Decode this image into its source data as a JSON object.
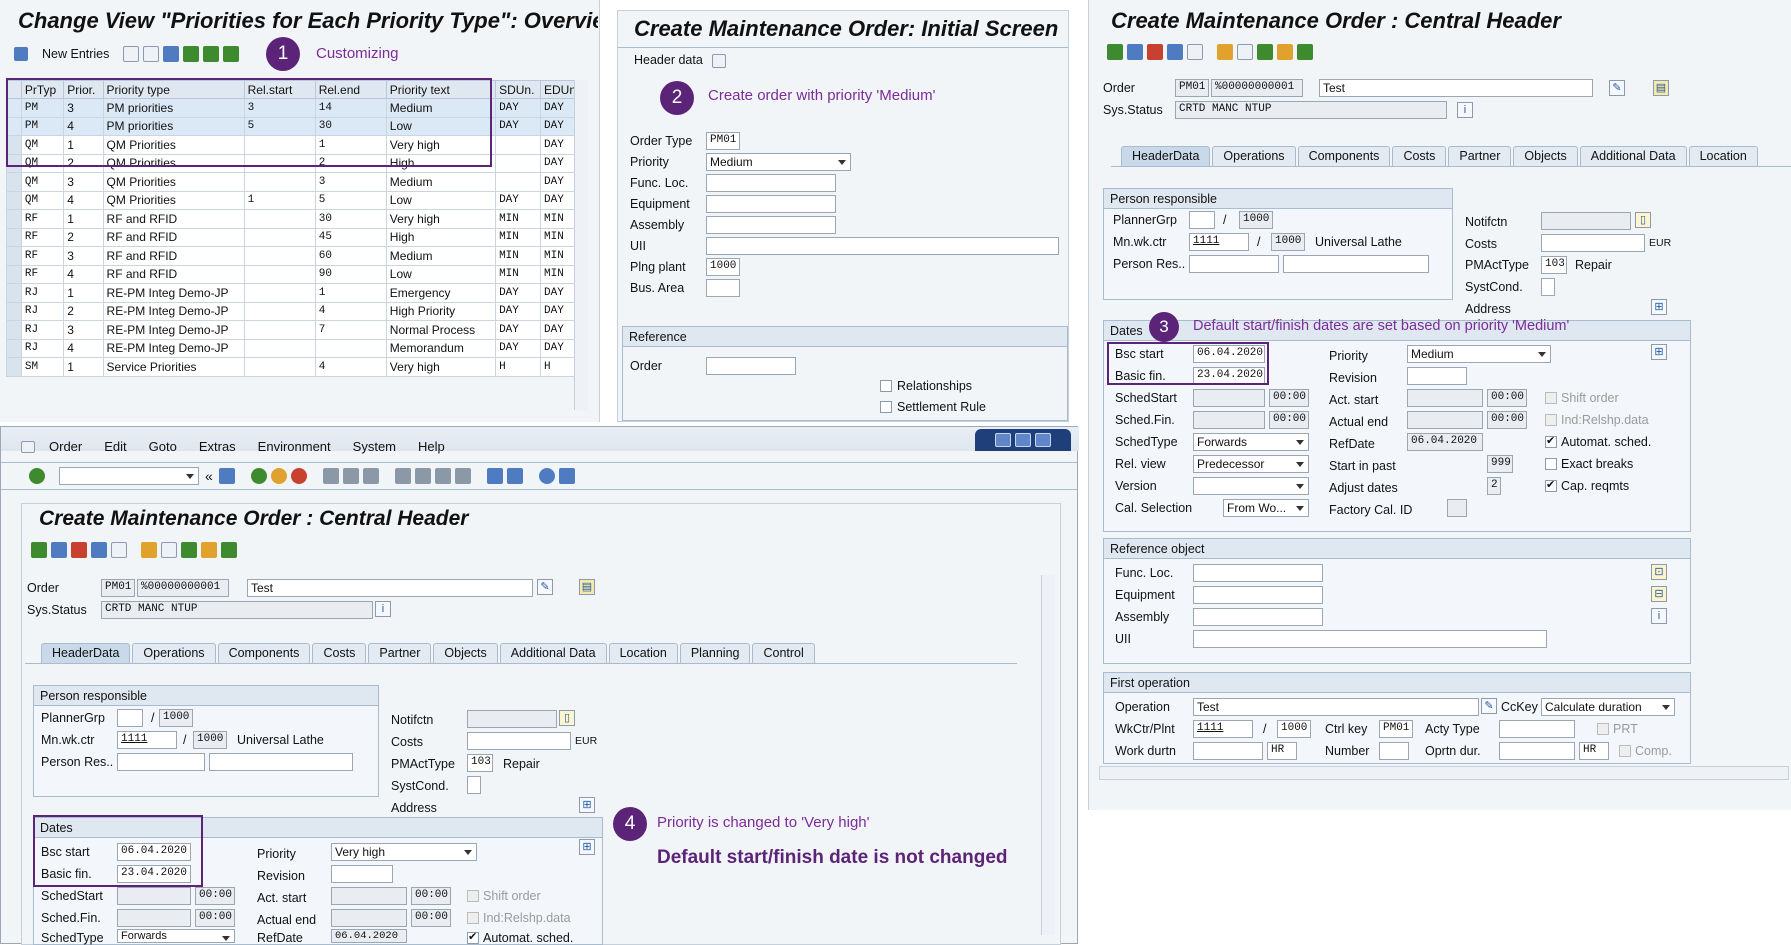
{
  "panel1": {
    "title": "Change View \"Priorities for Each Priority Type\": Overview",
    "new_entries": "New Entries",
    "annotation_num": "1",
    "annotation": "Customizing",
    "columns": [
      "PrTyp",
      "Prior.",
      "Priority type",
      "Rel.start",
      "Rel.end",
      "Priority text",
      "SDUn.",
      "EDUn."
    ],
    "rows": [
      [
        "PM",
        "3",
        "PM priorities",
        "3",
        "14",
        "Medium",
        "DAY",
        "DAY"
      ],
      [
        "PM",
        "4",
        "PM priorities",
        "5",
        "30",
        "Low",
        "DAY",
        "DAY"
      ],
      [
        "QM",
        "1",
        "QM Priorities",
        "",
        "1",
        "Very high",
        "",
        "DAY"
      ],
      [
        "QM",
        "2",
        "QM Priorities",
        "",
        "2",
        "High",
        "",
        "DAY"
      ],
      [
        "QM",
        "3",
        "QM Priorities",
        "",
        "3",
        "Medium",
        "",
        "DAY"
      ],
      [
        "QM",
        "4",
        "QM Priorities",
        "1",
        "5",
        "Low",
        "DAY",
        "DAY"
      ],
      [
        "RF",
        "1",
        "RF and RFID",
        "",
        "30",
        "Very high",
        "MIN",
        "MIN"
      ],
      [
        "RF",
        "2",
        "RF and RFID",
        "",
        "45",
        "High",
        "MIN",
        "MIN"
      ],
      [
        "RF",
        "3",
        "RF and RFID",
        "",
        "60",
        "Medium",
        "MIN",
        "MIN"
      ],
      [
        "RF",
        "4",
        "RF and RFID",
        "",
        "90",
        "Low",
        "MIN",
        "MIN"
      ],
      [
        "RJ",
        "1",
        "RE-PM Integ Demo-JP",
        "",
        "1",
        "Emergency",
        "DAY",
        "DAY"
      ],
      [
        "RJ",
        "2",
        "RE-PM Integ Demo-JP",
        "",
        "4",
        "High Priority",
        "DAY",
        "DAY"
      ],
      [
        "RJ",
        "3",
        "RE-PM Integ Demo-JP",
        "",
        "7",
        "Normal Process",
        "DAY",
        "DAY"
      ],
      [
        "RJ",
        "4",
        "RE-PM Integ Demo-JP",
        "",
        "",
        "Memorandum",
        "DAY",
        "DAY"
      ],
      [
        "SM",
        "1",
        "Service Priorities",
        "",
        "4",
        "Very high",
        "H",
        "H"
      ]
    ]
  },
  "panel2": {
    "title": "Create Maintenance Order: Initial Screen",
    "header_data": "Header data",
    "annotation_num": "2",
    "annotation": "Create order with priority 'Medium'",
    "order_type_label": "Order Type",
    "order_type": "PM01",
    "priority_label": "Priority",
    "priority": "Medium",
    "func_loc_label": "Func. Loc.",
    "equipment_label": "Equipment",
    "assembly_label": "Assembly",
    "uii_label": "UII",
    "plng_plant_label": "Plng plant",
    "plng_plant": "1000",
    "bus_area_label": "Bus. Area",
    "reference_header": "Reference",
    "order_label": "Order",
    "relationships": "Relationships",
    "settlement_rule": "Settlement Rule"
  },
  "panel3": {
    "title": "Create Maintenance Order : Central Header",
    "order_label": "Order",
    "order_type": "PM01",
    "order_num": "%00000000001",
    "order_text": "Test",
    "sys_status_label": "Sys.Status",
    "sys_status": "CRTD MANC NTUP",
    "tabs": [
      "HeaderData",
      "Operations",
      "Components",
      "Costs",
      "Partner",
      "Objects",
      "Additional Data",
      "Location"
    ],
    "person_header": "Person responsible",
    "planner_grp_label": "PlannerGrp",
    "planner_plant": "1000",
    "mnwkctr_label": "Mn.wk.ctr",
    "mnwkctr": "1111",
    "mnwkctr_plant": "1000",
    "mnwkctr_desc": "Universal Lathe",
    "person_res_label": "Person Res..",
    "notifctn_label": "Notifctn",
    "costs_label": "Costs",
    "currency": "EUR",
    "pmacttype_label": "PMActType",
    "pmacttype": "103",
    "pmacttype_desc": "Repair",
    "systcond_label": "SystCond.",
    "address_label": "Address",
    "dates_header": "Dates",
    "annotation_num": "3",
    "annotation": "Default start/finish dates are set based on priority 'Medium'",
    "bsc_start_label": "Bsc start",
    "bsc_start": "06.04.2020",
    "basic_fin_label": "Basic fin.",
    "basic_fin": "23.04.2020",
    "schedstart_label": "SchedStart",
    "schedfin_label": "Sched.Fin.",
    "time_zero": "00:00",
    "schedtype_label": "SchedType",
    "schedtype": "Forwards",
    "relview_label": "Rel. view",
    "relview": "Predecessor",
    "version_label": "Version",
    "calsel_label": "Cal. Selection",
    "calsel": "From Wo...",
    "priority_label": "Priority",
    "priority": "Medium",
    "revision_label": "Revision",
    "actstart_label": "Act. start",
    "actualend_label": "Actual end",
    "refdate_label": "RefDate",
    "refdate": "06.04.2020",
    "startinpast_label": "Start in past",
    "startinpast": "999",
    "adjustdates_label": "Adjust dates",
    "adjustdates": "2",
    "factorycal_label": "Factory Cal. ID",
    "shift_order": "Shift order",
    "ind_relshp": "Ind:Relshp.data",
    "automat_sched": "Automat. sched.",
    "exact_breaks": "Exact breaks",
    "cap_reqmts": "Cap. reqmts",
    "refobj_header": "Reference object",
    "funcloc_label": "Func. Loc.",
    "equipment_label": "Equipment",
    "assembly_label": "Assembly",
    "uii_label": "UII",
    "firstop_header": "First operation",
    "operation_label": "Operation",
    "operation": "Test",
    "cckey_label": "CcKey",
    "cckey": "Calculate duration",
    "wkctr_label": "WkCtr/Plnt",
    "wkctr": "1111",
    "wkctr_plant": "1000",
    "ctrlkey_label": "Ctrl key",
    "ctrlkey": "PM01",
    "actytype_label": "Acty Type",
    "prt": "PRT",
    "workdurtn_label": "Work durtn",
    "unit_hr": "HR",
    "number_label": "Number",
    "oprtndur_label": "Oprtn dur.",
    "comp": "Comp."
  },
  "panel4": {
    "menu": [
      "Order",
      "Edit",
      "Goto",
      "Extras",
      "Environment",
      "System",
      "Help"
    ],
    "title": "Create Maintenance Order : Central Header",
    "order_label": "Order",
    "order_type": "PM01",
    "order_num": "%00000000001",
    "order_text": "Test",
    "sys_status_label": "Sys.Status",
    "sys_status": "CRTD MANC NTUP",
    "tabs": [
      "HeaderData",
      "Operations",
      "Components",
      "Costs",
      "Partner",
      "Objects",
      "Additional Data",
      "Location",
      "Planning",
      "Control"
    ],
    "person_header": "Person responsible",
    "planner_grp_label": "PlannerGrp",
    "planner_plant": "1000",
    "mnwkctr_label": "Mn.wk.ctr",
    "mnwkctr": "1111",
    "mnwkctr_plant": "1000",
    "mnwkctr_desc": "Universal Lathe",
    "person_res_label": "Person Res..",
    "notifctn_label": "Notifctn",
    "costs_label": "Costs",
    "currency": "EUR",
    "pmacttype_label": "PMActType",
    "pmacttype": "103",
    "pmacttype_desc": "Repair",
    "systcond_label": "SystCond.",
    "address_label": "Address",
    "dates_header": "Dates",
    "bsc_start_label": "Bsc start",
    "bsc_start": "06.04.2020",
    "basic_fin_label": "Basic fin.",
    "basic_fin": "23.04.2020",
    "schedstart_label": "SchedStart",
    "schedfin_label": "Sched.Fin.",
    "schedtype_label": "SchedType",
    "schedtype": "Forwards",
    "time_zero": "00:00",
    "priority_label": "Priority",
    "priority": "Very high",
    "revision_label": "Revision",
    "actstart_label": "Act. start",
    "actualend_label": "Actual end",
    "refdate_label": "RefDate",
    "refdate": "06.04.2020",
    "shift_order": "Shift order",
    "ind_relshp": "Ind:Relshp.data",
    "automat_sched": "Automat. sched.",
    "annotation_num": "4",
    "annotation": "Priority is changed to 'Very high'",
    "annotation2": "Default start/finish date is not changed"
  }
}
